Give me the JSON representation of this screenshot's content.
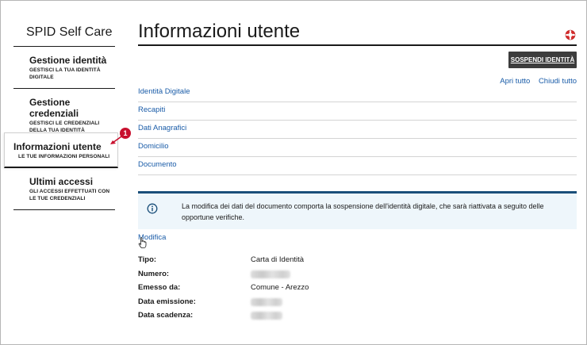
{
  "sidebar": {
    "brand": "SPID Self Care",
    "items": [
      {
        "title": "Gestione identità",
        "subtitle": "Gestisci la tua identità digitale"
      },
      {
        "title": "Gestione credenziali",
        "subtitle": "Gestisci le credenziali della tua identità"
      },
      {
        "title": "Informazioni utente",
        "subtitle": "Le tue informazioni personali"
      },
      {
        "title": "Ultimi accessi",
        "subtitle": "Gli accessi effettuati con le tue credenziali"
      }
    ]
  },
  "annotation": {
    "badge": "1",
    "color": "#c8102e"
  },
  "main": {
    "title": "Informazioni utente",
    "suspend_button": "SOSPENDI IDENTITÀ",
    "open_all": "Apri tutto",
    "close_all": "Chiudi tutto",
    "sections": [
      "Identità Digitale",
      "Recapiti",
      "Dati Anagrafici",
      "Domicilio",
      "Documento"
    ],
    "notice": "La modifica dei dati del documento comporta la sospensione dell'identità digitale, che sarà riattivata a seguito delle opportune verifiche.",
    "edit_link": "Modifica",
    "fields": [
      {
        "label": "Tipo:",
        "value": "Carta di Identità"
      },
      {
        "label": "Numero:",
        "value": ""
      },
      {
        "label": "Emesso da:",
        "value": "Comune - Arezzo"
      },
      {
        "label": "Data emissione:",
        "value": ""
      },
      {
        "label": "Data scadenza:",
        "value": ""
      }
    ]
  },
  "colors": {
    "link": "#1a5ca8",
    "button": "#3c3c3c",
    "notice_bg": "#eef6fb",
    "notice_border": "#1a4f7a"
  }
}
